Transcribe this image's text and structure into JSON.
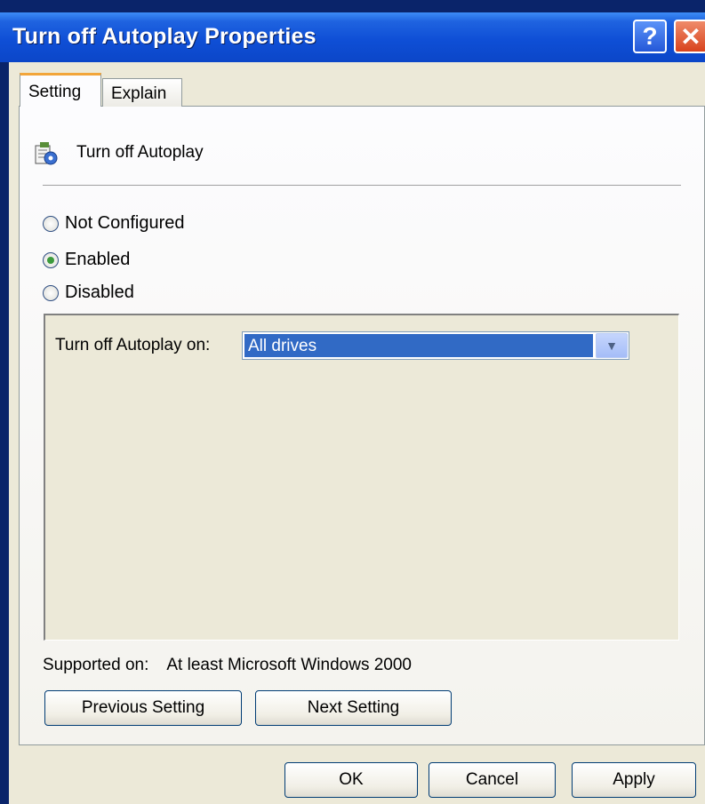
{
  "window": {
    "title": "Turn off Autoplay Properties",
    "help_label": "?",
    "close_label": "✕"
  },
  "tabs": [
    {
      "label": "Setting",
      "selected": true
    },
    {
      "label": "Explain",
      "selected": false
    }
  ],
  "policy": {
    "title": "Turn off Autoplay",
    "icon": "policy-setting-icon"
  },
  "state": {
    "options": [
      {
        "label": "Not Configured",
        "checked": false
      },
      {
        "label": "Enabled",
        "checked": true
      },
      {
        "label": "Disabled",
        "checked": false
      }
    ]
  },
  "autoplay_option": {
    "label": "Turn off Autoplay on:",
    "selected": "All drives"
  },
  "supported": {
    "label": "Supported on:",
    "value": "At least Microsoft Windows 2000"
  },
  "nav_buttons": {
    "previous": "Previous Setting",
    "next": "Next Setting"
  },
  "dialog_buttons": {
    "ok": "OK",
    "cancel": "Cancel",
    "apply": "Apply"
  }
}
